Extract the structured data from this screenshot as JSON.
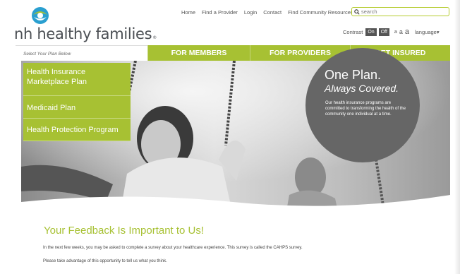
{
  "brand": {
    "name": "nh healthy families",
    "trademark": "®"
  },
  "top_nav": {
    "links": [
      "Home",
      "Find a Provider",
      "Login",
      "Contact",
      "Find Community Resources"
    ],
    "search_placeholder": "search"
  },
  "utility": {
    "contrast_label": "Contrast",
    "contrast_on": "On",
    "contrast_off": "Off",
    "text_sizes": [
      "a",
      "a",
      "a"
    ],
    "language_label": "language"
  },
  "main_nav": {
    "select_plan_hint": "Select Your Plan Below",
    "items": [
      "FOR MEMBERS",
      "FOR PROVIDERS",
      "GET INSURED"
    ]
  },
  "plans": [
    "Health Insurance Marketplace Plan",
    "Medicaid Plan",
    "Health Protection Program"
  ],
  "promo": {
    "headline": "One Plan.",
    "subheadline": "Always Covered.",
    "body": "Our health insurance programs are committed to transforming the health of the community one individual at a time."
  },
  "feedback": {
    "title": "Your Feedback Is Important to Us!",
    "paragraph1": "In the next few weeks, you may be asked to complete a survey about your healthcare experience.  This survey is called the CAHPS survey.",
    "paragraph2": "Please take advantage of this opportunity to tell us what you think."
  },
  "colors": {
    "accent_green": "#a7c133",
    "bubble_gray": "#666666",
    "logo_blue": "#2a9fd0"
  },
  "icons": {
    "logo": "nh-healthy-families-logo",
    "search": "search-icon",
    "language_caret": "chevron-down-icon"
  }
}
